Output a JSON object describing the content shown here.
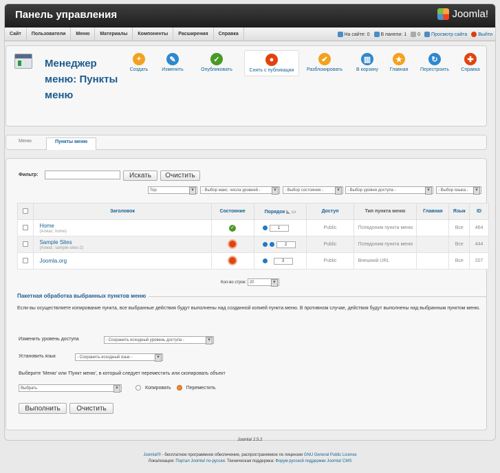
{
  "app_title": "Панель управления",
  "logo_text": "Joomla!",
  "menu": [
    "Сайт",
    "Пользователи",
    "Меню",
    "Материалы",
    "Компоненты",
    "Расширения",
    "Справка"
  ],
  "status": {
    "online": "На сайте: 0",
    "admin": "В панели: 1",
    "messages": "0",
    "view_site": "Просмотр сайта",
    "logout": "Выйти"
  },
  "page_title_lines": [
    "Менеджер",
    "меню: Пункты",
    "меню"
  ],
  "toolbar": [
    {
      "label": "Создать",
      "color": "#f3a21f",
      "icon": "plus-icon",
      "glyph": "+"
    },
    {
      "label": "Изменить",
      "color": "#2e88cf",
      "icon": "pencil-icon",
      "glyph": "✎"
    },
    {
      "label": "Опубликовать",
      "color": "#4a9a26",
      "icon": "check-icon",
      "glyph": "✓"
    },
    {
      "label": "Снять с публикации",
      "color": "#e0440e",
      "icon": "unpublish-icon",
      "glyph": "●"
    },
    {
      "label": "Разблокировать",
      "color": "#f3a21f",
      "icon": "checkmark-icon",
      "glyph": "✔"
    },
    {
      "label": "В корзину",
      "color": "#2e88cf",
      "icon": "trash-icon",
      "glyph": "▥"
    },
    {
      "label": "Главная",
      "color": "#f3a21f",
      "icon": "star-icon",
      "glyph": "★"
    },
    {
      "label": "Перестроить",
      "color": "#2e88cf",
      "icon": "refresh-icon",
      "glyph": "↻"
    },
    {
      "label": "Справка",
      "color": "#e0440e",
      "icon": "help-icon",
      "glyph": "✚"
    }
  ],
  "tabs": [
    "Меню",
    "Пункты меню"
  ],
  "filter": {
    "label": "Фильтр:",
    "search_btn": "Искать",
    "clear_btn": "Очистить",
    "selects": [
      "Top",
      "- Выбор макс. числа уровней -",
      "- Выбор состояния -",
      "- Выбор уровня доступа -",
      "- Выбор языка -"
    ]
  },
  "columns": [
    "Заголовок",
    "Состояние",
    "Порядок",
    "Доступ",
    "Тип пункта меню",
    "Главная",
    "Язык",
    "ID"
  ],
  "rows": [
    {
      "title": "Home",
      "alias": "(Алиас: home)",
      "state": "published",
      "order": "1",
      "access": "Public",
      "type": "Псевдоним пункта меню",
      "lang": "Все",
      "id": "464"
    },
    {
      "title": "Sample Sites",
      "alias": "(Алиас: sample-sites-2)",
      "state": "unpublished",
      "order": "2",
      "access": "Public",
      "type": "Псевдоним пункта меню",
      "lang": "Все",
      "id": "444"
    },
    {
      "title": "Joomla.org",
      "alias": "",
      "state": "unpublished",
      "order": "3",
      "access": "Public",
      "type": "Внешний URL",
      "lang": "Все",
      "id": "207"
    }
  ],
  "rows_count": {
    "label": "Кол-во строк:",
    "value": "20"
  },
  "batch": {
    "legend": "Пакетная обработка выбранных пунктов меню",
    "desc": "Если вы осуществляете копирование пункта, все выбранные действия будут выполнены над созданной копией пункта меню. В противном случае, действия будут выполнены над выбранным пунктом меню.",
    "access_label": "Изменить уровень доступа",
    "access_value": "- Сохранить исходный уровень доступа -",
    "lang_label": "Установить язык",
    "lang_value": "- Сохранить исходный язык -",
    "target_label": "Выберите 'Меню' или 'Пункт меню', в который следует переместить или скопировать объект",
    "target_value": "Выбрать",
    "copy": "Копировать",
    "move": "Переместить",
    "run_btn": "Выполнить",
    "clear_btn": "Очистить"
  },
  "footer": {
    "version": "Joomla! 2.5.2",
    "line1a": "Joomla!®",
    "line1b": " - бесплатное программное обеспечение, распространяемое по лицензии ",
    "line1c": "GNU General Public License",
    "line2a": "Локализация: ",
    "line2b": "Портал Joomla! по-русски",
    "line2c": ". Техническая поддержка: ",
    "line2d": "Форум русской поддержки Joomla! CMS"
  }
}
